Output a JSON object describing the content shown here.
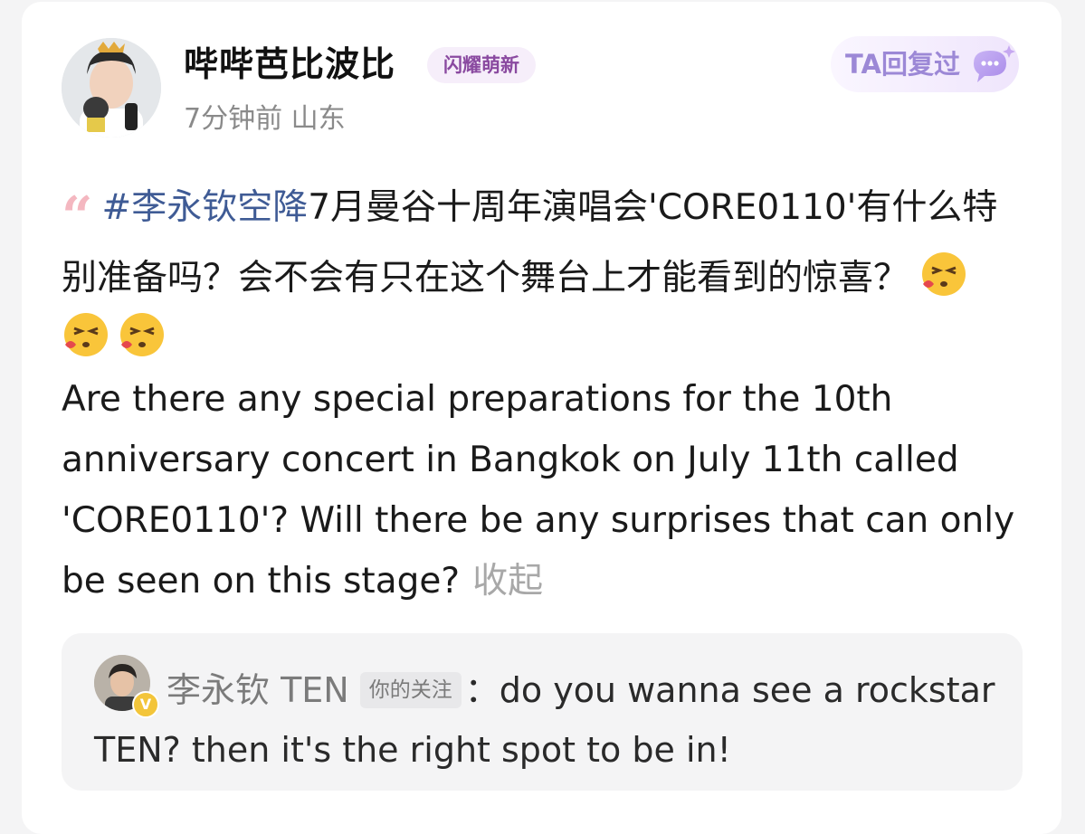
{
  "post": {
    "username": "哔哔芭比波比",
    "badge": "闪耀萌新",
    "time": "7分钟前",
    "location": "山东",
    "replied_label": "TA回复过",
    "replied_icon": "chat-bubble-icon",
    "quote_icon": "quote-mark-icon",
    "quote_glyph": "“",
    "hashtag": "#李永钦空降",
    "text_zh": "7月曼谷十周年演唱会'CORE0110'有什么特别准备吗？会不会有只在这个舞台上才能看到的惊喜？",
    "emojis": [
      "kissing-face-icon",
      "kissing-face-icon",
      "kissing-face-icon"
    ],
    "text_en": "Are there any special preparations for the 10th anniversary concert in Bangkok on July 11th called 'CORE0110'? Will there be any surprises that can only be seen on this stage?",
    "collapse_label": "收起"
  },
  "reply": {
    "author": "李永钦 TEN",
    "follow_tag": "你的关注",
    "separator": "：",
    "text": "do you wanna see a rockstar TEN? then it's the right spot to be in!",
    "verified_glyph": "V"
  },
  "colors": {
    "hashtag": "#3f5b95",
    "badge_text": "#8a4aa0",
    "replied_text": "#9c88d6",
    "collapse": "#a8a8a8"
  }
}
